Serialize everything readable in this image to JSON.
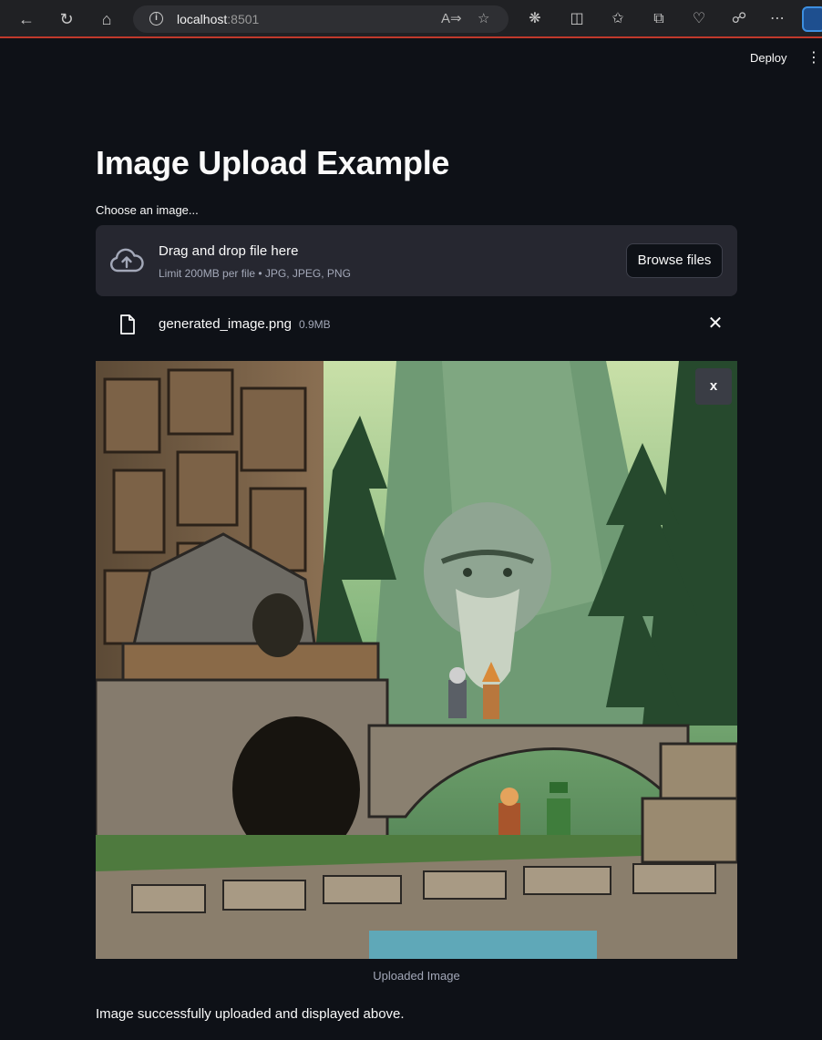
{
  "browser": {
    "url_host": "localhost",
    "url_port": ":8501",
    "nav_icons": [
      "back-icon",
      "reload-icon",
      "home-icon"
    ],
    "toolbar_icons": [
      "read-aloud-icon",
      "favorite-star-icon",
      "extensions-icon",
      "split-screen-icon",
      "favorites-icon",
      "collections-icon",
      "health-icon",
      "workspaces-icon",
      "more-icon",
      "bing-copilot-icon"
    ]
  },
  "header": {
    "deploy_label": "Deploy",
    "menu_icon": "vertical-dots-icon"
  },
  "main": {
    "title": "Image Upload Example",
    "uploader_label": "Choose an image...",
    "dropzone": {
      "title": "Drag and drop file here",
      "limit": "Limit 200MB per file • JPG, JPEG, PNG",
      "browse_label": "Browse files",
      "icon": "cloud-upload-icon"
    },
    "uploaded_file": {
      "name": "generated_image.png",
      "size": "0.9MB",
      "icon": "file-icon"
    },
    "image": {
      "close_label": "x",
      "caption": "Uploaded Image"
    },
    "status_message": "Image successfully uploaded and displayed above."
  },
  "colors": {
    "background": "#0e1117",
    "dropzone": "#262730",
    "muted_text": "#a3a8b8",
    "text": "#fafafa"
  }
}
